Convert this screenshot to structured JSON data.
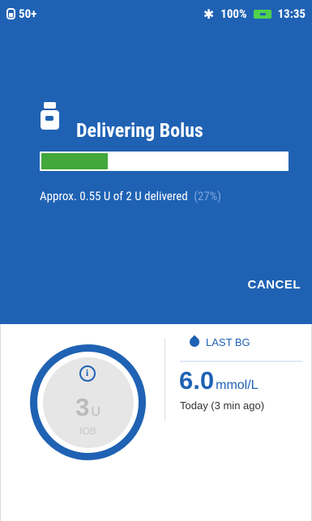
{
  "status_bar": {
    "pod_label": "50+",
    "battery_percent": "100%",
    "time": "13:35",
    "icons": {
      "pod": "pod-icon",
      "bluetooth": "bluetooth-icon",
      "battery": "battery-icon"
    }
  },
  "delivery": {
    "title": "Delivering Bolus",
    "progress_fraction": 0.27,
    "progress_text": "Approx. 0.55 U of 2 U delivered",
    "progress_percent": "(27%)",
    "cancel_label": "CANCEL"
  },
  "summary": {
    "iob_value": "3",
    "iob_unit": "U",
    "iob_label": "IOB",
    "last_bg_label": "LAST BG",
    "bg_value": "6.0",
    "bg_unit": "mmol/L",
    "bg_time": "Today (3 min ago)"
  },
  "colors": {
    "primary_blue": "#1f62b4",
    "progress_green": "#42a83b",
    "battery_green": "#4fd24a"
  }
}
